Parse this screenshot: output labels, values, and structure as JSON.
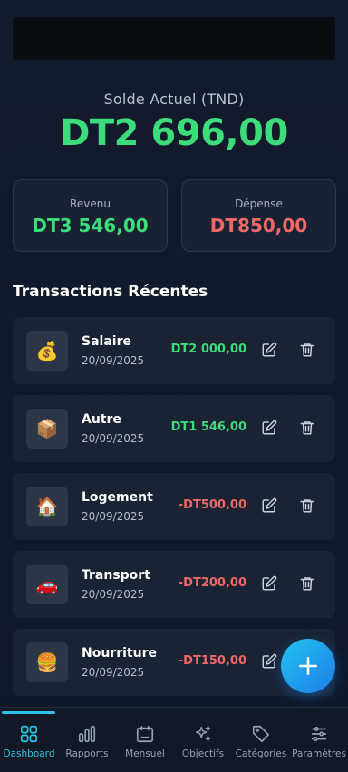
{
  "balance": {
    "label": "Solde Actuel (TND)",
    "value": "DT2 696,00"
  },
  "summary": {
    "income_label": "Revenu",
    "income_value": "DT3 546,00",
    "expense_label": "Dépense",
    "expense_value": "DT850,00"
  },
  "transactions_title": "Transactions Récentes",
  "transactions": [
    {
      "name": "Salaire",
      "date": "20/09/2025",
      "amount": "DT2 000,00",
      "type": "income",
      "icon": "money-bag-icon"
    },
    {
      "name": "Autre",
      "date": "20/09/2025",
      "amount": "DT1 546,00",
      "type": "income",
      "icon": "package-icon"
    },
    {
      "name": "Logement",
      "date": "20/09/2025",
      "amount": "-DT500,00",
      "type": "expense",
      "icon": "house-icon"
    },
    {
      "name": "Transport",
      "date": "20/09/2025",
      "amount": "-DT200,00",
      "type": "expense",
      "icon": "car-icon"
    },
    {
      "name": "Nourriture",
      "date": "20/09/2025",
      "amount": "-DT150,00",
      "type": "expense",
      "icon": "burger-icon"
    }
  ],
  "nav": [
    {
      "label": "Dashboard",
      "icon": "grid-icon",
      "active": true
    },
    {
      "label": "Rapports",
      "icon": "bar-chart-icon"
    },
    {
      "label": "Mensuel",
      "icon": "calendar-icon"
    },
    {
      "label": "Objectifs",
      "icon": "sparkle-icon"
    },
    {
      "label": "Catégories",
      "icon": "tag-icon"
    },
    {
      "label": "Paramètres",
      "icon": "sliders-icon"
    }
  ],
  "colors": {
    "income": "#3ddc7a",
    "expense": "#f06868",
    "accent": "#2ec4e8",
    "background": "#111a2b"
  }
}
